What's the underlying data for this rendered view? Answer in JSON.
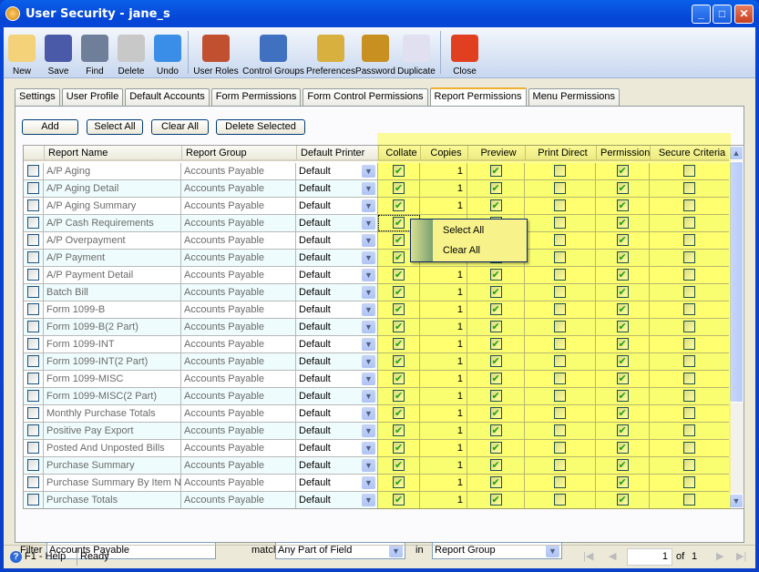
{
  "window": {
    "title": "User Security - jane_s"
  },
  "toolbar": [
    {
      "label": "New",
      "icon": "new-icon"
    },
    {
      "label": "Save",
      "icon": "save-icon"
    },
    {
      "label": "Find",
      "icon": "binoculars-icon"
    },
    {
      "label": "Delete",
      "icon": "recycle-bin-icon"
    },
    {
      "label": "Undo",
      "icon": "undo-icon"
    },
    {
      "label": "User Roles",
      "icon": "users-icon"
    },
    {
      "label": "Control Groups",
      "icon": "control-groups-icon"
    },
    {
      "label": "Preferences",
      "icon": "preferences-icon"
    },
    {
      "label": "Password",
      "icon": "lock-icon"
    },
    {
      "label": "Duplicate",
      "icon": "duplicate-icon"
    },
    {
      "label": "Close",
      "icon": "close-icon"
    }
  ],
  "tabs": [
    "Settings",
    "User Profile",
    "Default Accounts",
    "Form Permissions",
    "Form Control Permissions",
    "Report Permissions",
    "Menu Permissions"
  ],
  "active_tab": "Report Permissions",
  "actions": {
    "add": "Add",
    "select_all": "Select All",
    "clear_all": "Clear All",
    "delete_selected": "Delete Selected"
  },
  "columns": [
    "Report Name",
    "Report Group",
    "Default Printer",
    "Collate",
    "Copies",
    "Preview",
    "Print Direct",
    "Permission",
    "Secure Criteria"
  ],
  "rows": [
    {
      "name": "A/P Aging",
      "group": "Accounts Payable",
      "printer": "Default",
      "collate": true,
      "copies": "1",
      "preview": true,
      "print_direct": false,
      "permission": true,
      "secure": false
    },
    {
      "name": "A/P Aging Detail",
      "group": "Accounts Payable",
      "printer": "Default",
      "collate": true,
      "copies": "1",
      "preview": true,
      "print_direct": false,
      "permission": true,
      "secure": false
    },
    {
      "name": "A/P Aging Summary",
      "group": "Accounts Payable",
      "printer": "Default",
      "collate": true,
      "copies": "1",
      "preview": true,
      "print_direct": false,
      "permission": true,
      "secure": false
    },
    {
      "name": "A/P Cash Requirements",
      "group": "Accounts Payable",
      "printer": "Default",
      "collate": true,
      "copies": "1",
      "preview": true,
      "print_direct": false,
      "permission": true,
      "secure": false
    },
    {
      "name": "A/P Overpayment",
      "group": "Accounts Payable",
      "printer": "Default",
      "collate": true,
      "copies": "1",
      "preview": true,
      "print_direct": false,
      "permission": true,
      "secure": false
    },
    {
      "name": "A/P Payment",
      "group": "Accounts Payable",
      "printer": "Default",
      "collate": true,
      "copies": "1",
      "preview": true,
      "print_direct": false,
      "permission": true,
      "secure": false
    },
    {
      "name": "A/P Payment Detail",
      "group": "Accounts Payable",
      "printer": "Default",
      "collate": true,
      "copies": "1",
      "preview": true,
      "print_direct": false,
      "permission": true,
      "secure": false
    },
    {
      "name": "Batch Bill",
      "group": "Accounts Payable",
      "printer": "Default",
      "collate": true,
      "copies": "1",
      "preview": true,
      "print_direct": false,
      "permission": true,
      "secure": false
    },
    {
      "name": "Form 1099-B",
      "group": "Accounts Payable",
      "printer": "Default",
      "collate": true,
      "copies": "1",
      "preview": true,
      "print_direct": false,
      "permission": true,
      "secure": false
    },
    {
      "name": "Form 1099-B(2 Part)",
      "group": "Accounts Payable",
      "printer": "Default",
      "collate": true,
      "copies": "1",
      "preview": true,
      "print_direct": false,
      "permission": true,
      "secure": false
    },
    {
      "name": "Form 1099-INT",
      "group": "Accounts Payable",
      "printer": "Default",
      "collate": true,
      "copies": "1",
      "preview": true,
      "print_direct": false,
      "permission": true,
      "secure": false
    },
    {
      "name": "Form 1099-INT(2 Part)",
      "group": "Accounts Payable",
      "printer": "Default",
      "collate": true,
      "copies": "1",
      "preview": true,
      "print_direct": false,
      "permission": true,
      "secure": false
    },
    {
      "name": "Form 1099-MISC",
      "group": "Accounts Payable",
      "printer": "Default",
      "collate": true,
      "copies": "1",
      "preview": true,
      "print_direct": false,
      "permission": true,
      "secure": false
    },
    {
      "name": "Form 1099-MISC(2 Part)",
      "group": "Accounts Payable",
      "printer": "Default",
      "collate": true,
      "copies": "1",
      "preview": true,
      "print_direct": false,
      "permission": true,
      "secure": false
    },
    {
      "name": "Monthly Purchase Totals",
      "group": "Accounts Payable",
      "printer": "Default",
      "collate": true,
      "copies": "1",
      "preview": true,
      "print_direct": false,
      "permission": true,
      "secure": false
    },
    {
      "name": "Positive Pay Export",
      "group": "Accounts Payable",
      "printer": "Default",
      "collate": true,
      "copies": "1",
      "preview": true,
      "print_direct": false,
      "permission": true,
      "secure": false
    },
    {
      "name": "Posted And Unposted Bills",
      "group": "Accounts Payable",
      "printer": "Default",
      "collate": true,
      "copies": "1",
      "preview": true,
      "print_direct": false,
      "permission": true,
      "secure": false
    },
    {
      "name": "Purchase Summary",
      "group": "Accounts Payable",
      "printer": "Default",
      "collate": true,
      "copies": "1",
      "preview": true,
      "print_direct": false,
      "permission": true,
      "secure": false
    },
    {
      "name": "Purchase Summary By Item Nu",
      "group": "Accounts Payable",
      "printer": "Default",
      "collate": true,
      "copies": "1",
      "preview": true,
      "print_direct": false,
      "permission": true,
      "secure": false
    },
    {
      "name": "Purchase Totals",
      "group": "Accounts Payable",
      "printer": "Default",
      "collate": true,
      "copies": "1",
      "preview": true,
      "print_direct": false,
      "permission": true,
      "secure": false
    }
  ],
  "context_menu": {
    "select_all": "Select All",
    "clear_all": "Clear All"
  },
  "filter": {
    "label": "Filter",
    "value": "Accounts Payable",
    "matching_label": "matching",
    "matching_value": "Any Part of Field",
    "in_label": "in",
    "field_value": "Report Group"
  },
  "status": {
    "help": "F1 - Help",
    "text": "Ready",
    "page": "1",
    "of_label": "of",
    "total_pages": "1"
  }
}
